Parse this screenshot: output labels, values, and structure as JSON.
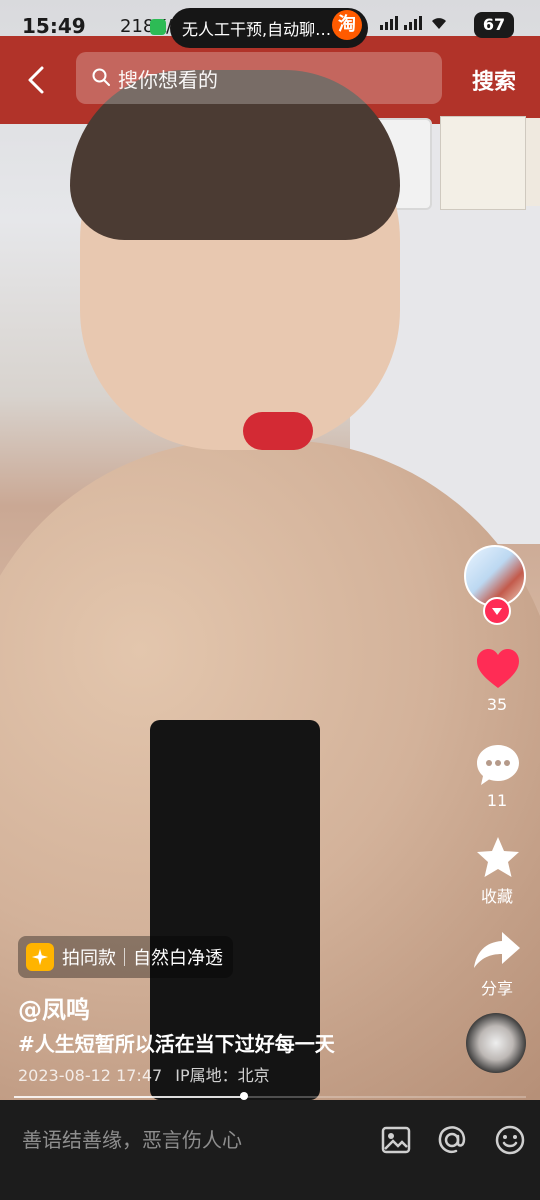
{
  "status_bar": {
    "time": "15:49",
    "network_speed": "218K/s",
    "notification": "无人工干预,自动聊…",
    "taobao_glyph": "淘",
    "battery": "67"
  },
  "header": {
    "search_placeholder": "搜你想看的",
    "search_button": "搜索"
  },
  "actions": {
    "likes": "35",
    "comments": "11",
    "favorite": "收藏",
    "share": "分享"
  },
  "content": {
    "chip_label": "拍同款",
    "chip_effect": "自然白净透",
    "author": "@凤鸣",
    "description": "#人生短暂所以活在当下过好每一天",
    "date": "2023-08-12 17:47",
    "ip_location": "IP属地：北京"
  },
  "playback": {
    "progress": 0.45
  },
  "bottom_bar": {
    "placeholder": "善语结善缘，恶言伤人心"
  },
  "colors": {
    "like_red": "#ff2c55",
    "banner_red": "#b13329",
    "input_bar_bg": "#1c1c1c"
  },
  "icons": [
    "back-icon",
    "search-icon",
    "like-icon",
    "comment-icon",
    "favorite-star-icon",
    "share-arrow-icon",
    "music-disc-icon",
    "sparkle-icon",
    "image-icon",
    "mention-icon",
    "emoji-icon",
    "wifi-icon",
    "signal-icon"
  ]
}
